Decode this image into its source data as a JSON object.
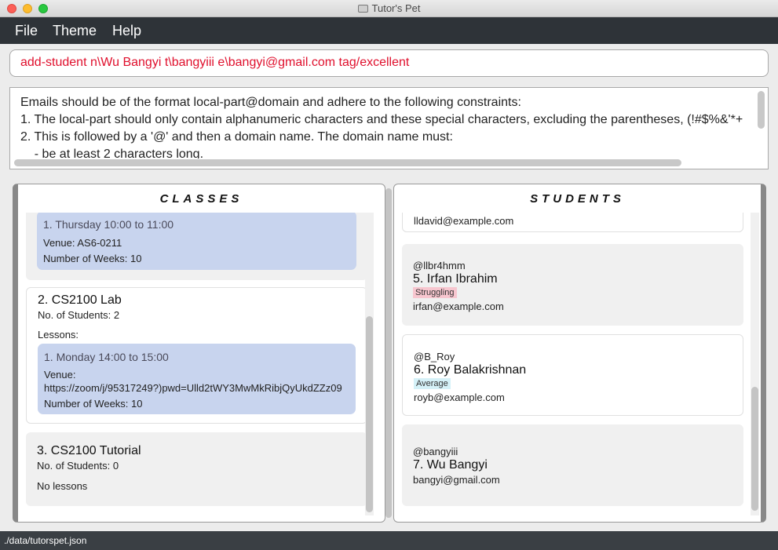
{
  "window": {
    "title": "Tutor's Pet"
  },
  "menu": {
    "file": "File",
    "theme": "Theme",
    "help": "Help"
  },
  "command": {
    "value": "add-student n\\Wu Bangyi t\\bangyiii e\\bangyi@gmail.com tag/excellent"
  },
  "result": {
    "lines": [
      "Emails should be of the format local-part@domain and adhere to the following constraints:",
      "1. The local-part should only contain alphanumeric characters and these special characters, excluding the parentheses, (!#$%&'*+",
      "2. This is followed by a '@' and then a domain name. The domain name must:",
      "    - be at least 2 characters long."
    ]
  },
  "classes": {
    "header": "CLASSES",
    "items": [
      {
        "lessons": [
          {
            "time": "1. Thursday 10:00 to 11:00",
            "venue": "Venue: AS6-0211",
            "weeks": "Number of Weeks: 10"
          }
        ]
      },
      {
        "title": "2.  CS2100 Lab",
        "students": "No. of Students:  2",
        "lessons_label": "Lessons:",
        "lessons": [
          {
            "time": "1. Monday 14:00 to 15:00",
            "venue_label": "Venue:",
            "venue": "https://zoom/j/95317249?)pwd=Ulld2tWY3MwMkRibjQyUkdZZz09",
            "weeks": "Number of Weeks: 10"
          }
        ]
      },
      {
        "title": "3.  CS2100 Tutorial",
        "students": "No. of Students:  0",
        "lessons_label": "No lessons"
      }
    ]
  },
  "students": {
    "header": "STUDENTS",
    "items": [
      {
        "email": "lldavid@example.com"
      },
      {
        "handle": "@llbr4hmm",
        "name": "5.  Irfan Ibrahim",
        "tag": "Struggling",
        "email": "irfan@example.com"
      },
      {
        "handle": "@B_Roy",
        "name": "6.  Roy Balakrishnan",
        "tag": "Average",
        "email": "royb@example.com"
      },
      {
        "handle": "@bangyiii",
        "name": "7.  Wu Bangyi",
        "email": "bangyi@gmail.com"
      }
    ]
  },
  "status": {
    "path": "./data/tutorspet.json"
  }
}
